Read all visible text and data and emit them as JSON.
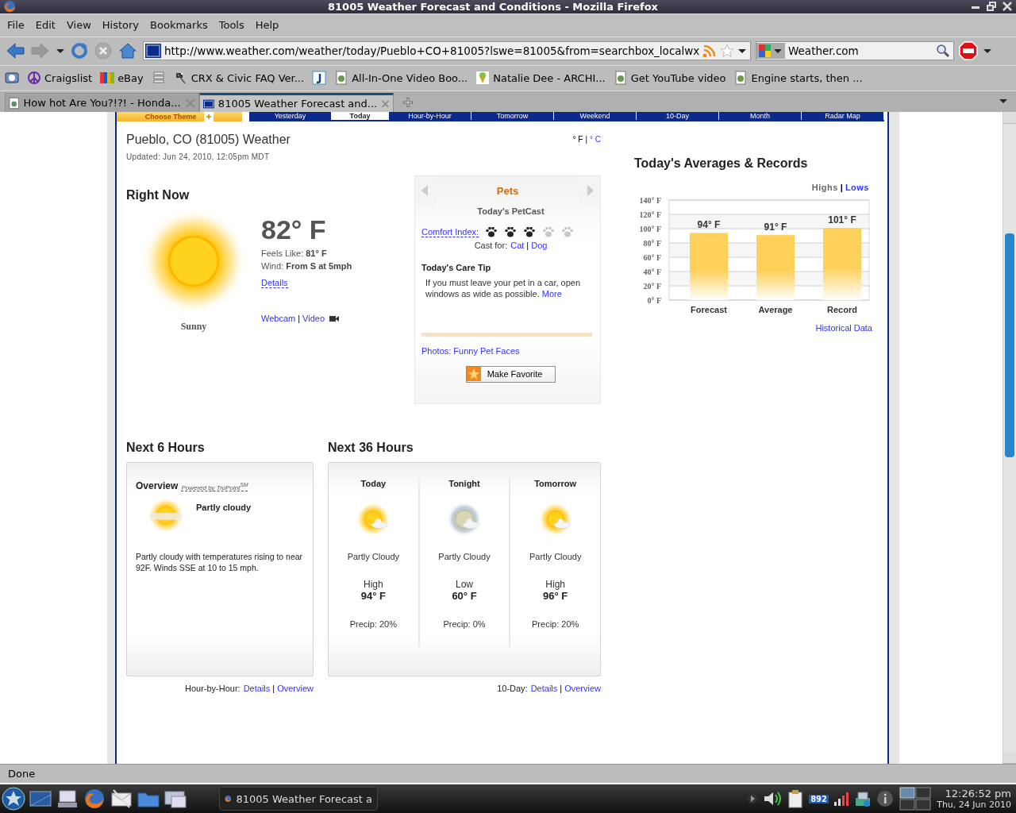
{
  "window": {
    "title": "81005 Weather Forecast and Conditions - Mozilla Firefox"
  },
  "menu": [
    "File",
    "Edit",
    "View",
    "History",
    "Bookmarks",
    "Tools",
    "Help"
  ],
  "toolbar": {
    "url": "http://www.weather.com/weather/today/Pueblo+CO+81005?lswe=81005&from=searchbox_localwx",
    "search": "Weather.com"
  },
  "bookmarks": [
    {
      "kind": "icon"
    },
    {
      "kind": "link",
      "label": "Craigslist"
    },
    {
      "kind": "link",
      "label": "eBay"
    },
    {
      "kind": "icon"
    },
    {
      "kind": "link",
      "label": "CRX & Civic FAQ Ver..."
    },
    {
      "kind": "icon"
    },
    {
      "kind": "link",
      "label": "All-In-One Video Boo..."
    },
    {
      "kind": "link",
      "label": "Natalie Dee - ARCHI..."
    },
    {
      "kind": "link",
      "label": "Get YouTube video"
    },
    {
      "kind": "link",
      "label": "Engine starts, then ..."
    }
  ],
  "tabs": [
    {
      "label": "How hot Are You?!?! - Honda...",
      "selected": false
    },
    {
      "label": "81005 Weather Forecast and...",
      "selected": true
    }
  ],
  "site_nav": {
    "theme": "Choose Theme",
    "tabs": [
      {
        "label": "Yesterday",
        "selected": false
      },
      {
        "label": "Today",
        "selected": true
      },
      {
        "label": "Hour-by-Hour",
        "selected": false
      },
      {
        "label": "Tomorrow",
        "selected": false
      },
      {
        "label": "Weekend",
        "selected": false
      },
      {
        "label": "10-Day",
        "selected": false
      },
      {
        "label": "Month",
        "selected": false
      },
      {
        "label": "Radar Map",
        "selected": false
      }
    ]
  },
  "header": {
    "location": "Pueblo, CO (81005) Weather",
    "updated": "Updated: Jun 24, 2010, 12:05pm MDT",
    "units": [
      {
        "label": "° F",
        "selected": true
      },
      {
        "label": "° C",
        "selected": false
      }
    ],
    "separator": "|"
  },
  "right_now": {
    "heading": "Right Now",
    "temp": "82° F",
    "feels": "Feels Like: **81° F**",
    "wind": "Wind: **From S at 5mph**",
    "details": "Details",
    "condition": "Sunny",
    "links": [
      "Webcam",
      "Video"
    ],
    "separator": "|"
  },
  "pets": {
    "title": "Pets",
    "subtitle": "Today's PetCast",
    "comfort_label": "Comfort Index:",
    "stars": 3,
    "cast_label": "Cast for:",
    "cast_links": [
      "Cat",
      "Dog"
    ],
    "separator": "|",
    "tip_title": "Today's Care Tip",
    "tip": "If you must leave your pet in a car, open windows as wide as possible.",
    "tip_link": "More",
    "photos_link": "Photos: Funny Pet Faces",
    "favorite_button": "Make Favorite"
  },
  "averages": {
    "heading": "Today's Averages & Records",
    "toggle": [
      {
        "label": "Highs",
        "selected": true
      },
      {
        "label": "Lows",
        "selected": false
      }
    ],
    "separator": "|",
    "chart_data": {
      "type": "bar",
      "grid": true,
      "categories": [
        "Forecast",
        "Average",
        "Record"
      ],
      "values": [
        94,
        91,
        101
      ],
      "value_labels": [
        "94° F",
        "91° F",
        "101° F"
      ],
      "ylim": [
        0,
        140
      ],
      "yticks": [
        {
          "value": 0,
          "label": "0° F"
        },
        {
          "value": 20,
          "label": "20° F"
        },
        {
          "value": 40,
          "label": "40° F"
        },
        {
          "value": 60,
          "label": "60° F"
        },
        {
          "value": 80,
          "label": "80° F"
        },
        {
          "value": 100,
          "label": "100° F"
        },
        {
          "value": 120,
          "label": "120° F"
        },
        {
          "value": 140,
          "label": "140° F"
        }
      ]
    },
    "history_link": "Historical Data"
  },
  "next6": {
    "heading": "Next 6 Hours",
    "overview": "Overview",
    "powered": "Powered by TruPoint$^{SM}$",
    "condition": "Partly cloudy",
    "text": "Partly cloudy with temperatures rising to near 92F. Winds SSE at 10 to 15 mph.",
    "footer_label": "Hour-by-Hour:",
    "links": [
      "Details",
      "Overview"
    ],
    "separator": "|"
  },
  "next36": {
    "heading": "Next 36 Hours",
    "periods": [
      {
        "kind": "day",
        "name": "Today",
        "condition": "Partly Cloudy",
        "temp_label": "High",
        "temp": "94° F",
        "precip": "Precip: 20%"
      },
      {
        "kind": "night",
        "name": "Tonight",
        "condition": "Partly Cloudy",
        "temp_label": "Low",
        "temp": "60° F",
        "precip": "Precip: 0%"
      },
      {
        "kind": "day",
        "name": "Tomorrow",
        "condition": "Partly Cloudy",
        "temp_label": "High",
        "temp": "96° F",
        "precip": "Precip: 20%"
      }
    ],
    "footer_label": "10-Day:",
    "links": [
      "Details",
      "Overview"
    ],
    "separator": "|"
  },
  "status_bar": {
    "text": "Done"
  },
  "taskbar": {
    "task": "81005 Weather Forecast a",
    "badge": "892",
    "time": "12:26:52 pm",
    "date": "Thu, 24 Jun 2010"
  }
}
